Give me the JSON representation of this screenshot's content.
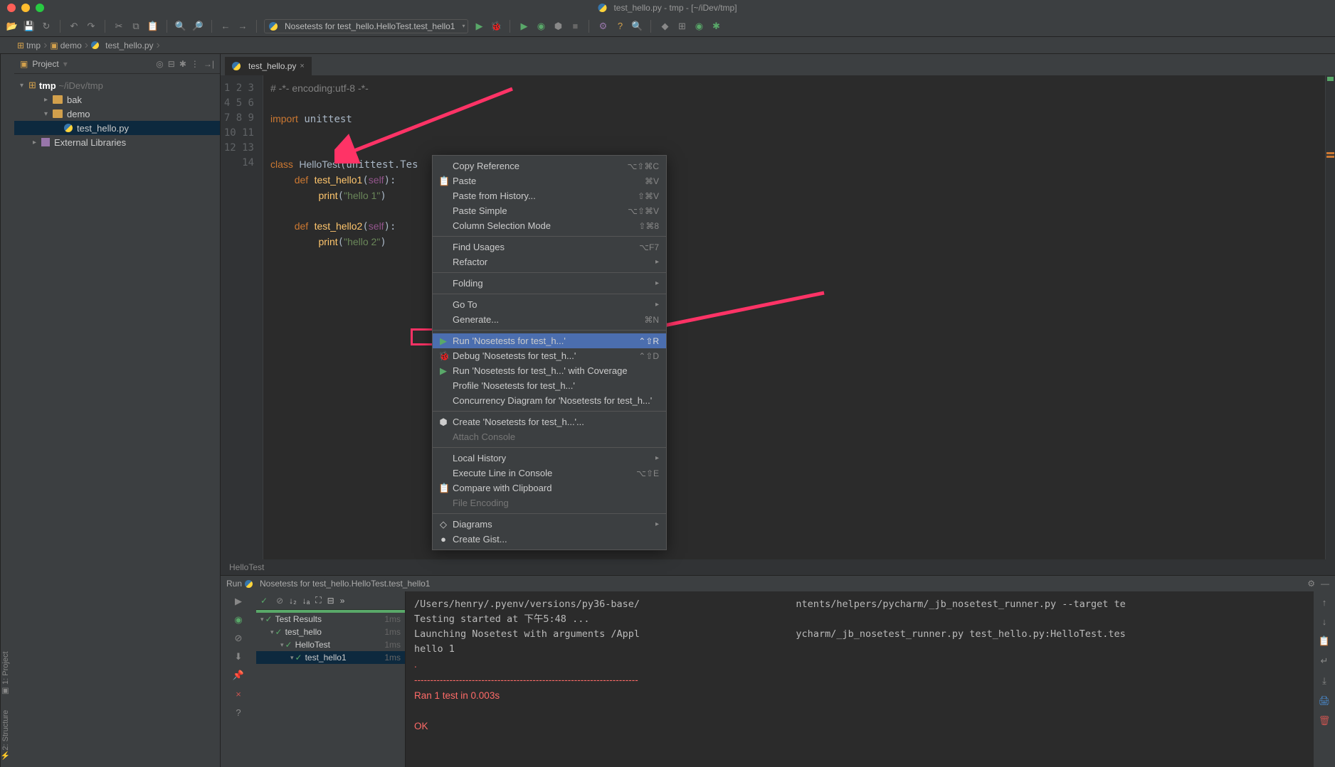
{
  "title": "test_hello.py - tmp - [~/iDev/tmp]",
  "run_config": "Nosetests for test_hello.HelloTest.test_hello1",
  "breadcrumbs": [
    "tmp",
    "demo",
    "test_hello.py"
  ],
  "sidebar": {
    "header": "Project",
    "root_name": "tmp",
    "root_path": "~/iDev/tmp",
    "items": [
      {
        "name": "bak",
        "type": "folder",
        "indent": 1
      },
      {
        "name": "demo",
        "type": "folder",
        "indent": 1,
        "expanded": true
      },
      {
        "name": "test_hello.py",
        "type": "py",
        "indent": 2,
        "selected": true
      },
      {
        "name": "External Libraries",
        "type": "lib",
        "indent": 0
      }
    ]
  },
  "tab": {
    "label": "test_hello.py"
  },
  "status_crumb": "HelloTest",
  "gutter_lines": [
    "1",
    "2",
    "3",
    "4",
    "5",
    "6",
    "7",
    "8",
    "9",
    "10",
    "11",
    "12",
    "13",
    "14"
  ],
  "code_html": "<span class='com'># -*- encoding:utf-8 -*-</span>\n\n<span class='kw'>import</span> unittest\n\n\n<span class='kw'>class</span> <span class='cls'>HelloTest</span>(unittest.Tes\n    <span class='kw'>def</span> <span class='fn'>test_hello1</span>(<span class='self'>self</span>):\n        <span class='fn'>print</span>(<span class='str'>\"hello 1\"</span>)\n\n    <span class='kw'>def</span> <span class='fn'>test_hello2</span>(<span class='self'>self</span>):\n        <span class='fn'>print</span>(<span class='str'>\"hello 2\"</span>)\n\n\n",
  "run_panel": {
    "title_prefix": "Run",
    "title": "Nosetests for test_hello.HelloTest.test_hello1",
    "tests": [
      {
        "label": "Test Results",
        "time": "1ms",
        "indent": 0
      },
      {
        "label": "test_hello",
        "time": "1ms",
        "indent": 1
      },
      {
        "label": "HelloTest",
        "time": "1ms",
        "indent": 2
      },
      {
        "label": "test_hello1",
        "time": "1ms",
        "indent": 3,
        "selected": true
      }
    ],
    "console_html": "/Users/henry/.pyenv/versions/py36-base/                           ntents/helpers/pycharm/_jb_nosetest_runner.py --target te\nTesting started at 下午5:48 ...\nLaunching Nosetest with arguments /Appl                           ycharm/_jb_nosetest_runner.py test_hello.py:HelloTest.tes\nhello 1\n<span class='err'>.</span>\n<span class='err'>----------------------------------------------------------------------</span>\n<span class='err'>Ran 1 test in 0.003s</span>\n\n<span class='err'>OK</span>"
  },
  "ctx": [
    {
      "label": "Copy Reference",
      "sc": "⌥⇧⌘C"
    },
    {
      "label": "Paste",
      "sc": "⌘V",
      "ico": "📋"
    },
    {
      "label": "Paste from History...",
      "sc": "⇧⌘V"
    },
    {
      "label": "Paste Simple",
      "sc": "⌥⇧⌘V"
    },
    {
      "label": "Column Selection Mode",
      "sc": "⇧⌘8"
    },
    {
      "sep": true
    },
    {
      "label": "Find Usages",
      "sc": "⌥F7"
    },
    {
      "label": "Refactor",
      "sub": true
    },
    {
      "sep": true
    },
    {
      "label": "Folding",
      "sub": true
    },
    {
      "sep": true
    },
    {
      "label": "Go To",
      "sub": true
    },
    {
      "label": "Generate...",
      "sc": "⌘N"
    },
    {
      "sep": true
    },
    {
      "label": "Run 'Nosetests for test_h...'",
      "sc": "⌃⇧R",
      "ico": "▶",
      "sel": true,
      "icoClass": "run-ico-g"
    },
    {
      "label": "Debug 'Nosetests for test_h...'",
      "sc": "⌃⇧D",
      "ico": "🐞",
      "icoClass": "bug-ico"
    },
    {
      "label": "Run 'Nosetests for test_h...' with Coverage",
      "ico": "▶",
      "icoClass": "run-ico-g"
    },
    {
      "label": "Profile 'Nosetests for test_h...'"
    },
    {
      "label": "Concurrency Diagram for  'Nosetests for test_h...'"
    },
    {
      "sep": true
    },
    {
      "label": "Create 'Nosetests for test_h...'...",
      "ico": "⬢"
    },
    {
      "label": "Attach Console",
      "dis": true
    },
    {
      "sep": true
    },
    {
      "label": "Local History",
      "sub": true
    },
    {
      "label": "Execute Line in Console",
      "sc": "⌥⇧E"
    },
    {
      "label": "Compare with Clipboard",
      "ico": "📋"
    },
    {
      "label": "File Encoding",
      "dis": true
    },
    {
      "sep": true
    },
    {
      "label": "Diagrams",
      "sub": true,
      "ico": "◇"
    },
    {
      "label": "Create Gist...",
      "ico": "●"
    }
  ]
}
